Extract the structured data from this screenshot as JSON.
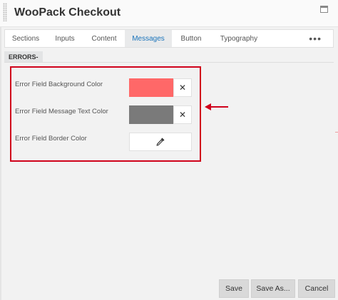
{
  "window": {
    "title": "WooPack Checkout"
  },
  "tabs": [
    {
      "label": "Sections",
      "active": false
    },
    {
      "label": "Inputs",
      "active": false
    },
    {
      "label": "Content",
      "active": false
    },
    {
      "label": "Messages",
      "active": true
    },
    {
      "label": "Button",
      "active": false
    },
    {
      "label": "Typography",
      "active": false
    }
  ],
  "tabs_more": "•••",
  "section": {
    "label": "ERRORS-"
  },
  "fields": [
    {
      "label": "Error Field Background Color",
      "color": "#ff6868",
      "clear": "✕"
    },
    {
      "label": "Error Field Message Text Color",
      "color": "#7a7a7a",
      "clear": "✕"
    },
    {
      "label": "Error Field Border Color"
    }
  ],
  "colors": {
    "accent": "#1b74bb",
    "highlight": "#d0021b"
  },
  "icons": {
    "picker": "eyedropper-icon",
    "clear": "close-icon",
    "arrow": "arrow-left-icon",
    "window": "window-icon"
  },
  "footer": {
    "save": "Save",
    "save_as": "Save As...",
    "cancel": "Cancel"
  }
}
